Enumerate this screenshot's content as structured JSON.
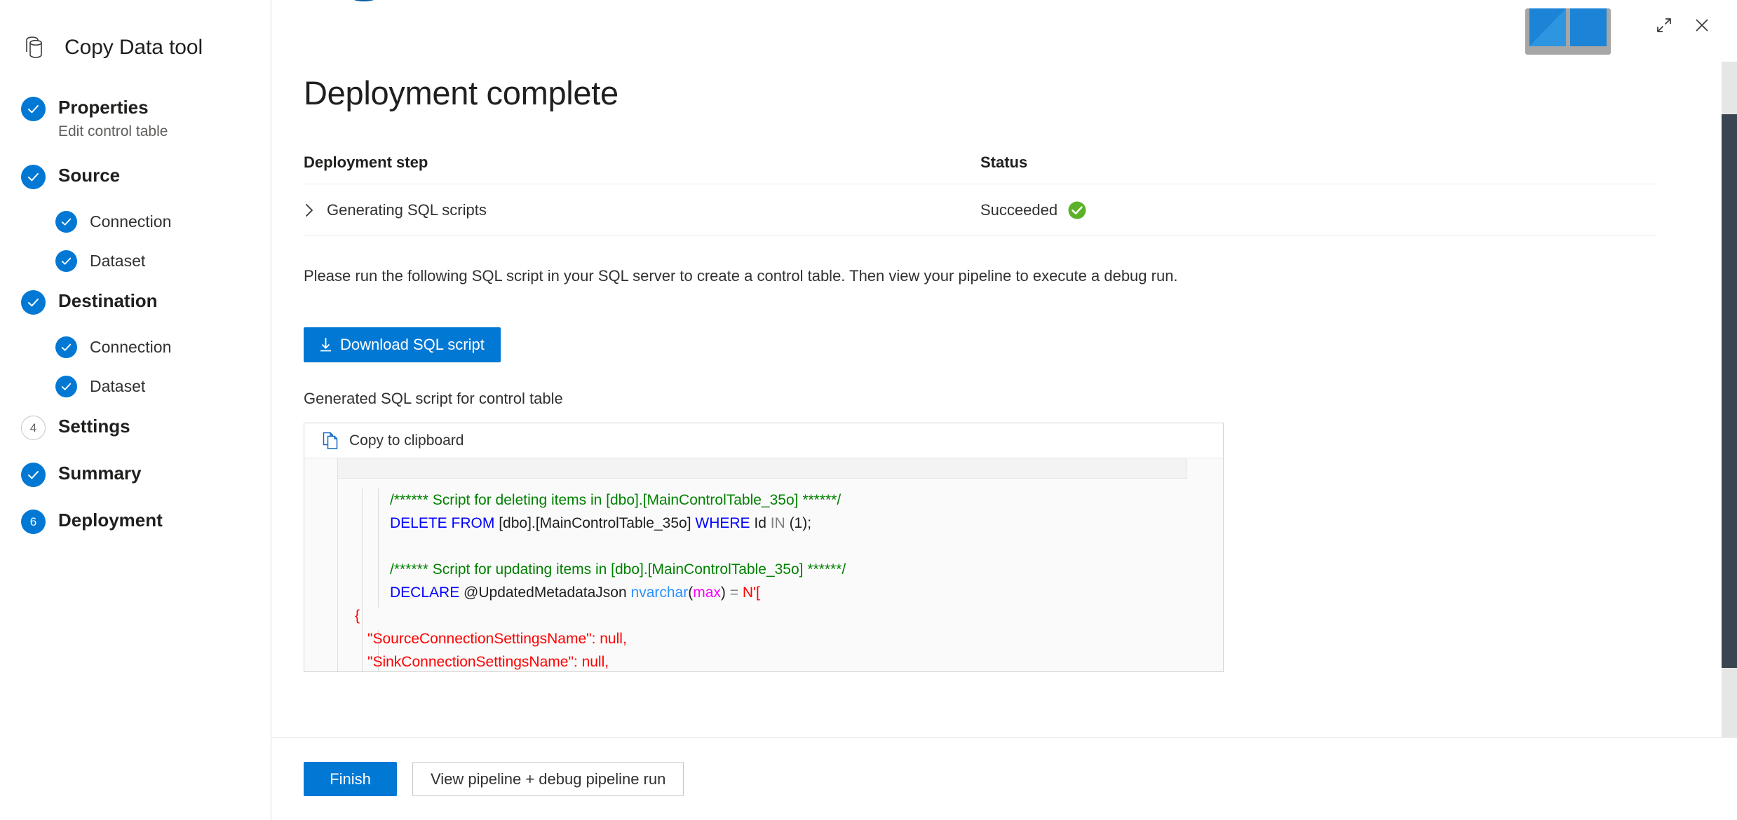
{
  "app": {
    "title": "Copy Data tool",
    "brand_icon": "database-copy-icon"
  },
  "window_controls": {
    "maximize_icon": "expand-diagonal-icon",
    "close_icon": "close-x-icon"
  },
  "sidebar": {
    "steps": [
      {
        "label": "Properties",
        "sublabel": "Edit control table",
        "state": "done",
        "level": 0,
        "marker": "check"
      },
      {
        "label": "Source",
        "sublabel": "",
        "state": "done",
        "level": 0,
        "marker": "check"
      },
      {
        "label": "Connection",
        "sublabel": "",
        "state": "done",
        "level": 1,
        "marker": "check"
      },
      {
        "label": "Dataset",
        "sublabel": "",
        "state": "done",
        "level": 1,
        "marker": "check"
      },
      {
        "label": "Destination",
        "sublabel": "",
        "state": "done",
        "level": 0,
        "marker": "check"
      },
      {
        "label": "Connection",
        "sublabel": "",
        "state": "done",
        "level": 1,
        "marker": "check"
      },
      {
        "label": "Dataset",
        "sublabel": "",
        "state": "done",
        "level": 1,
        "marker": "check"
      },
      {
        "label": "Settings",
        "sublabel": "",
        "state": "pending",
        "level": 0,
        "marker": "4"
      },
      {
        "label": "Summary",
        "sublabel": "",
        "state": "done",
        "level": 0,
        "marker": "check"
      },
      {
        "label": "Deployment",
        "sublabel": "",
        "state": "active",
        "level": 0,
        "marker": "6"
      }
    ]
  },
  "main": {
    "service_icon_left": "sql-database-icon",
    "service_icon_right": "dataset-table-icon",
    "page_title": "Deployment complete",
    "table": {
      "headers": {
        "step": "Deployment step",
        "status": "Status"
      },
      "rows": [
        {
          "expand_icon": "chevron-right-icon",
          "step": "Generating SQL scripts",
          "status": "Succeeded",
          "status_icon": "success-check-icon"
        }
      ]
    },
    "instruction": "Please run the following SQL script in your SQL server to create a control table. Then view your pipeline to execute a debug run.",
    "download_button": {
      "label": "Download SQL script",
      "icon": "download-arrow-icon"
    },
    "generated_label": "Generated SQL script for control table",
    "code_block": {
      "copy_label": "Copy to clipboard",
      "copy_icon": "copy-pages-icon",
      "lines": [
        {
          "indent": "ind1",
          "tokens": [
            {
              "t": "/****** Script for deleting items in [dbo].[MainControlTable_35o] ******/",
              "c": "tok-comment"
            }
          ]
        },
        {
          "indent": "ind1",
          "tokens": [
            {
              "t": "DELETE FROM",
              "c": "tok-kw"
            },
            {
              "t": " [dbo].[MainControlTable_35o] ",
              "c": "tok-plain"
            },
            {
              "t": "WHERE",
              "c": "tok-kw"
            },
            {
              "t": " Id ",
              "c": "tok-plain"
            },
            {
              "t": "IN",
              "c": "tok-op"
            },
            {
              "t": " (1);",
              "c": "tok-plain"
            }
          ]
        },
        {
          "indent": "blank",
          "tokens": []
        },
        {
          "indent": "ind1",
          "tokens": [
            {
              "t": "/****** Script for updating items in [dbo].[MainControlTable_35o] ******/",
              "c": "tok-comment"
            }
          ]
        },
        {
          "indent": "ind1",
          "tokens": [
            {
              "t": "DECLARE",
              "c": "tok-kw"
            },
            {
              "t": " @UpdatedMetadataJson ",
              "c": "tok-plain"
            },
            {
              "t": "nvarchar",
              "c": "tok-type"
            },
            {
              "t": "(",
              "c": "tok-plain"
            },
            {
              "t": "max",
              "c": "tok-magenta"
            },
            {
              "t": ") ",
              "c": "tok-plain"
            },
            {
              "t": "=",
              "c": "tok-op"
            },
            {
              "t": " N'[",
              "c": "tok-str"
            }
          ]
        },
        {
          "indent": "ind0",
          "tokens": [
            {
              "t": "{",
              "c": "tok-str"
            }
          ]
        },
        {
          "indent": "ind-json",
          "tokens": [
            {
              "t": "\"SourceConnectionSettingsName\": null,",
              "c": "tok-str"
            }
          ]
        },
        {
          "indent": "ind-json",
          "tokens": [
            {
              "t": "\"SinkConnectionSettingsName\": null,",
              "c": "tok-str"
            }
          ]
        }
      ]
    }
  },
  "footer": {
    "finish_label": "Finish",
    "view_pipeline_label": "View pipeline + debug pipeline run"
  },
  "colors": {
    "accent_blue": "#0078d4",
    "success_green": "#5cb227",
    "scrollbar_thumb": "#3b4552",
    "comment_green": "#008000",
    "keyword_blue": "#0000ff",
    "string_red": "#ff0000",
    "magenta": "#ff00ff"
  }
}
